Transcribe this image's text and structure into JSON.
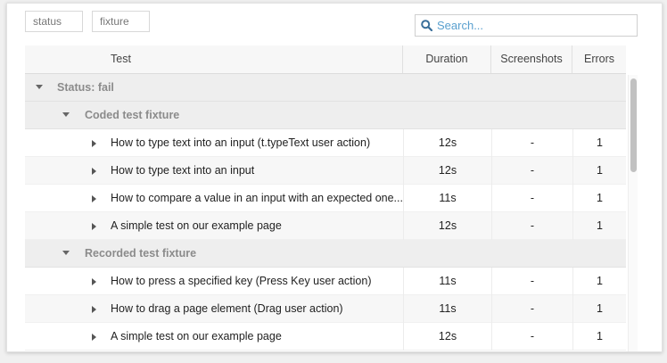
{
  "group_by": {
    "status": "status",
    "fixture": "fixture"
  },
  "search": {
    "placeholder": "Search..."
  },
  "columns": {
    "test": "Test",
    "duration": "Duration",
    "screenshots": "Screenshots",
    "errors": "Errors"
  },
  "groups": {
    "status": "Status: fail",
    "coded": "Coded test fixture",
    "recorded": "Recorded test fixture"
  },
  "rows": [
    {
      "name": "How to type text into an input (t.typeText user action)",
      "duration": "12s",
      "screenshots": "-",
      "errors": "1"
    },
    {
      "name": "How to type text into an input",
      "duration": "12s",
      "screenshots": "-",
      "errors": "1"
    },
    {
      "name": "How to compare a value in an input with an expected one...",
      "duration": "11s",
      "screenshots": "-",
      "errors": "1"
    },
    {
      "name": "A simple test on our example page",
      "duration": "12s",
      "screenshots": "-",
      "errors": "1"
    },
    {
      "name": "How to press a specified key (Press Key user action)",
      "duration": "11s",
      "screenshots": "-",
      "errors": "1"
    },
    {
      "name": "How to drag a page element (Drag user action)",
      "duration": "11s",
      "screenshots": "-",
      "errors": "1"
    },
    {
      "name": "A simple test on our example page",
      "duration": "12s",
      "screenshots": "-",
      "errors": "1"
    }
  ],
  "icons": {
    "search": "search-icon",
    "expand": "caret-down-icon",
    "collapsed": "caret-right-icon"
  },
  "colors": {
    "accent": "#5aa0cf",
    "group_text": "#8b8b8b"
  }
}
